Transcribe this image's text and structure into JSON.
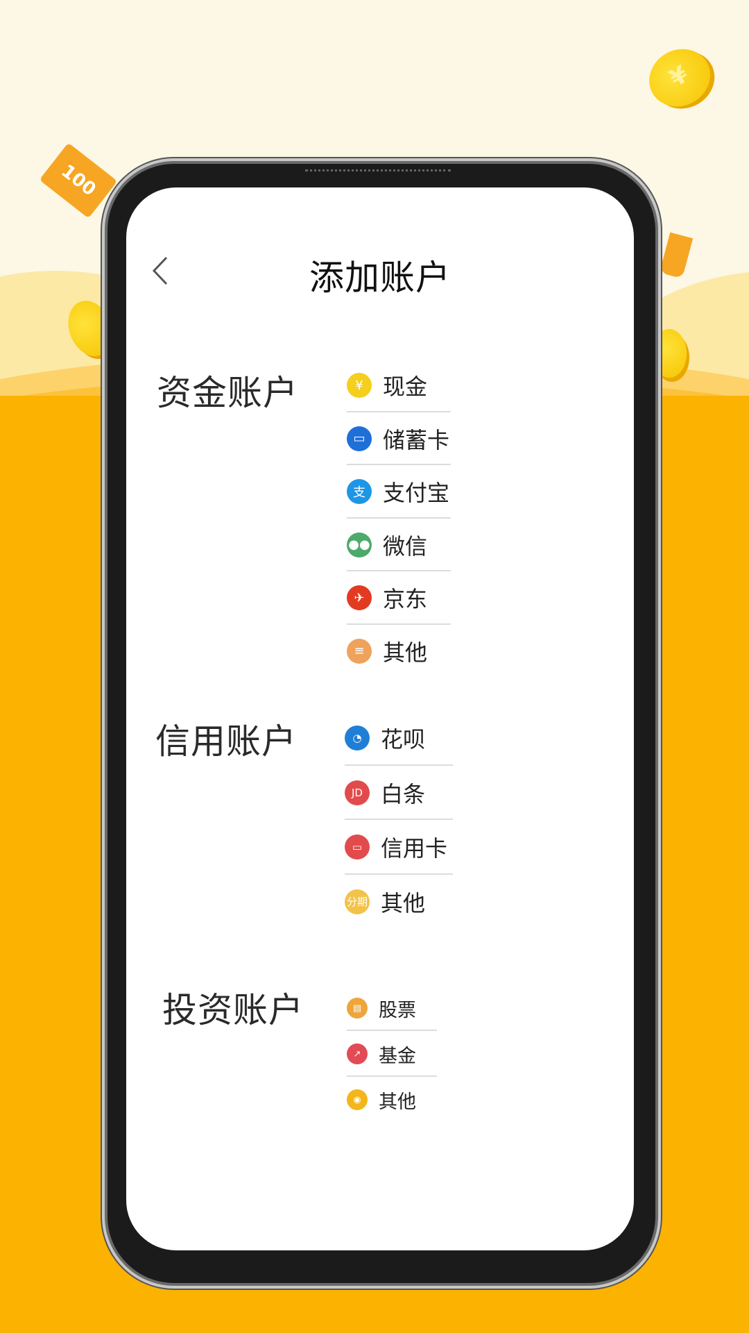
{
  "header": {
    "title": "添加账户",
    "back_icon": "chevron-left-icon"
  },
  "background": {
    "bill_label": "100",
    "coin_symbol": "¥",
    "colors": {
      "cream": "#fdf7e6",
      "orange": "#fcb200",
      "coin": "#f6c400"
    }
  },
  "sections": [
    {
      "title": "资金账户",
      "items": [
        {
          "label": "现金",
          "icon": "money-bag-icon",
          "glyph": "¥",
          "color": "#f5cf1c"
        },
        {
          "label": "储蓄卡",
          "icon": "debit-card-icon",
          "glyph": "▭",
          "color": "#1f6fd9"
        },
        {
          "label": "支付宝",
          "icon": "alipay-icon",
          "glyph": "支",
          "color": "#1e96e6"
        },
        {
          "label": "微信",
          "icon": "wechat-icon",
          "glyph": "●●",
          "color": "#4caa6a"
        },
        {
          "label": "京东",
          "icon": "jd-icon",
          "glyph": "✈",
          "color": "#e33a22"
        },
        {
          "label": "其他",
          "icon": "id-card-icon",
          "glyph": "≡",
          "color": "#efa25b"
        }
      ]
    },
    {
      "title": "信用账户",
      "items": [
        {
          "label": "花呗",
          "icon": "huabei-icon",
          "glyph": "◔",
          "color": "#1f7fd6"
        },
        {
          "label": "白条",
          "icon": "baitiao-icon",
          "glyph": "JD",
          "color": "#e24b4b"
        },
        {
          "label": "信用卡",
          "icon": "credit-card-icon",
          "glyph": "▭",
          "color": "#e24b4b"
        },
        {
          "label": "其他",
          "icon": "installment-icon",
          "glyph": "分期",
          "color": "#f2c24a"
        }
      ]
    },
    {
      "title": "投资账户",
      "items": [
        {
          "label": "股票",
          "icon": "stock-icon",
          "glyph": "▤",
          "color": "#eda53c"
        },
        {
          "label": "基金",
          "icon": "fund-chart-icon",
          "glyph": "↗",
          "color": "#e24b55"
        },
        {
          "label": "其他",
          "icon": "coin-icon",
          "glyph": "◉",
          "color": "#f2b61a"
        }
      ]
    }
  ]
}
